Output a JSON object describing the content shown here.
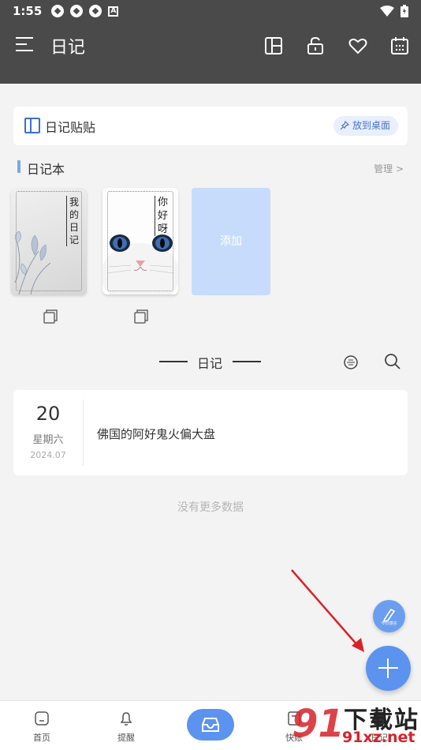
{
  "status": {
    "time": "1:55",
    "a_badge": "A"
  },
  "appbar": {
    "title": "日记"
  },
  "sticker": {
    "label": "日记贴贴",
    "pin_label": "放到桌面"
  },
  "notebooks": {
    "title": "日记本",
    "manage": "管理 >",
    "items": [
      {
        "title": "我的日记"
      },
      {
        "title": "你好呀"
      }
    ],
    "add_label": "添加"
  },
  "diary": {
    "title": "日记",
    "entries": [
      {
        "day": "20",
        "weekday": "星期六",
        "year_month": "2024.07",
        "content": "佛国的阿好鬼火偏大盘"
      }
    ],
    "no_more": "没有更多数据"
  },
  "fab": {
    "small_label": "今日感言"
  },
  "bottom_nav": [
    {
      "label": "首页"
    },
    {
      "label": "提醒"
    },
    {
      "label": ""
    },
    {
      "label": "快账"
    },
    {
      "label": "日记"
    }
  ],
  "watermark": {
    "brand": "下载站",
    "url": "91xz.net",
    "logo": "91"
  },
  "colors": {
    "header": "#4a4a4a",
    "accent": "#5b93ee",
    "add_book": "#c7dcfb",
    "arrow": "#d8222a"
  }
}
